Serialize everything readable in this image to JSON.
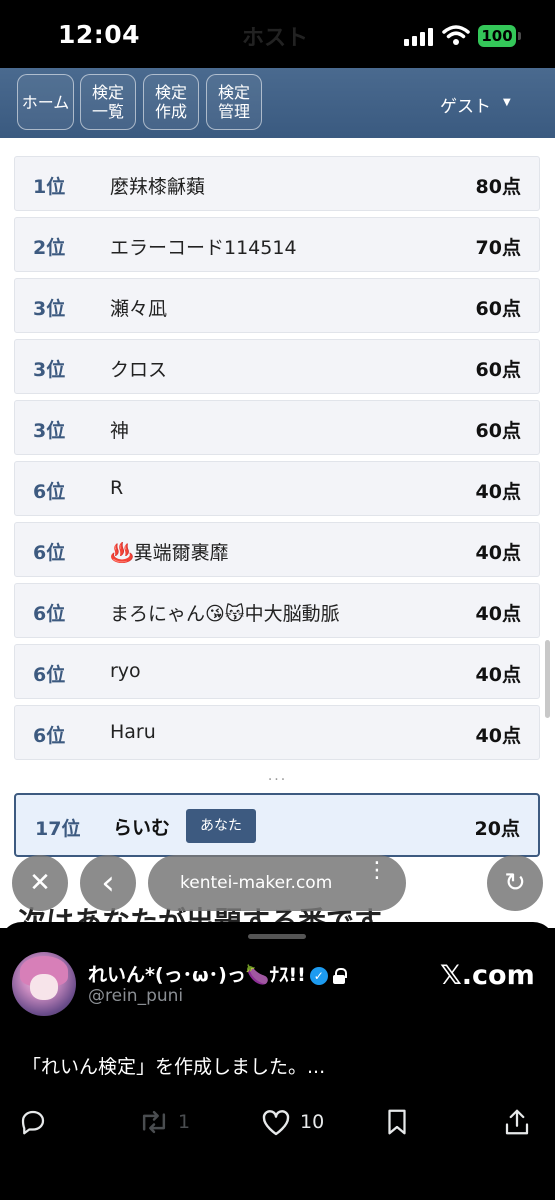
{
  "status_bar": {
    "time": "12:04",
    "battery": "100",
    "behind_title": "ホスト"
  },
  "nav": {
    "home": "ホーム",
    "list": [
      "検定",
      "一覧"
    ],
    "create": [
      "検定",
      "作成"
    ],
    "manage": [
      "検定",
      "管理"
    ],
    "user": "ゲスト",
    "caret": "▼"
  },
  "ranking": [
    {
      "rank": "1位",
      "name": "麼䍪㯃龢蘱",
      "score": "80点"
    },
    {
      "rank": "2位",
      "name": "エラーコード114514",
      "score": "70点"
    },
    {
      "rank": "3位",
      "name": "瀬々凪",
      "score": "60点"
    },
    {
      "rank": "3位",
      "name": "クロス",
      "score": "60点"
    },
    {
      "rank": "3位",
      "name": "神",
      "score": "60点"
    },
    {
      "rank": "6位",
      "name": "R",
      "score": "40点"
    },
    {
      "rank": "6位",
      "name": "♨️異端爾裹靡",
      "score": "40点"
    },
    {
      "rank": "6位",
      "name": "まろにゃん😘😽中大脳動脈",
      "score": "40点"
    },
    {
      "rank": "6位",
      "name": "ryo",
      "score": "40点"
    },
    {
      "rank": "6位",
      "name": "Haru",
      "score": "40点"
    }
  ],
  "ellipsis": "...",
  "my_result": {
    "rank": "17位",
    "name": "らいむ",
    "badge": "あなた",
    "score": "20点"
  },
  "partial_heading": "次はあなたが出題する番です",
  "browser": {
    "close": "✕",
    "back": "‹",
    "url": "kentei-maker.com",
    "more": "⋮",
    "reload": "↻"
  },
  "x_card": {
    "display_name": "れいん*(っ･ω･)っ🍆ﾅｽ!!",
    "handle": "@rein_puni",
    "logo": "𝕏.com",
    "tweet": "「れいん検定」を作成しました。...",
    "verified_mark": "✓",
    "retweets": "1",
    "likes": "10"
  },
  "icons": {
    "reply": "reply-icon",
    "retweet": "retweet-icon",
    "like": "heart-icon",
    "bookmark": "bookmark-icon",
    "share": "share-icon"
  }
}
